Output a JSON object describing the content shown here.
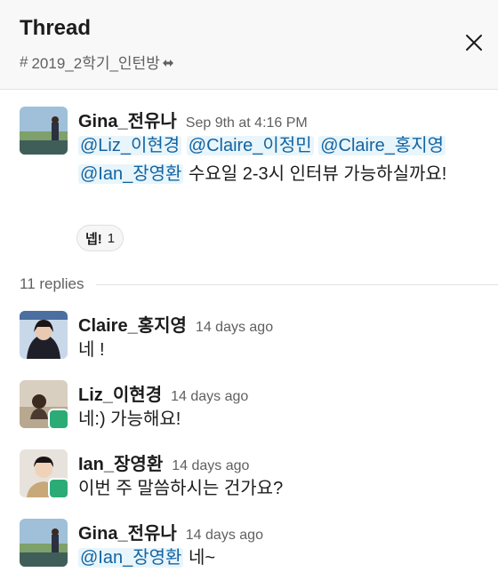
{
  "header": {
    "title": "Thread",
    "channel_hash": "#",
    "channel_name": "2019_2학기_인턴방"
  },
  "parent": {
    "author": "Gina_전유나",
    "time": "Sep 9th at 4:16 PM",
    "mentions": [
      "@Liz_이현경",
      "@Claire_이정민",
      "@Claire_홍지영",
      "@Ian_장영환"
    ],
    "text": "수요일 2-3시 인터뷰 가능하실까요!",
    "reaction": {
      "emoji": "넵!",
      "count": "1"
    }
  },
  "replies_label": "11 replies",
  "replies": [
    {
      "author": "Claire_홍지영",
      "time": "14 days ago",
      "text": "네 !"
    },
    {
      "author": "Liz_이현경",
      "time": "14 days ago",
      "text": "네:) 가능해요!"
    },
    {
      "author": "Ian_장영환",
      "time": "14 days ago",
      "text": "이번 주 말씀하시는 건가요?"
    },
    {
      "author": "Gina_전유나",
      "time": "14 days ago",
      "mention": "@Ian_장영환",
      "text": "네~"
    }
  ],
  "colors": {
    "mention_bg": "#e8f5fa",
    "mention_text": "#1264a3",
    "status_badge": "#2bac76"
  }
}
